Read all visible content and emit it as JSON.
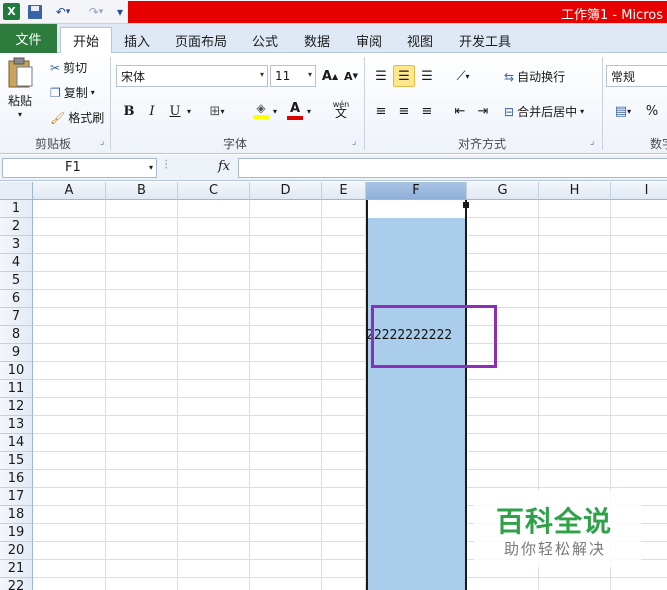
{
  "window": {
    "title": "工作簿1 - Micros"
  },
  "quick_access": {
    "undo_arrow": "▾",
    "more": "▾"
  },
  "ribbon_tabs": [
    {
      "label": "文件"
    },
    {
      "label": "开始"
    },
    {
      "label": "插入"
    },
    {
      "label": "页面布局"
    },
    {
      "label": "公式"
    },
    {
      "label": "数据"
    },
    {
      "label": "审阅"
    },
    {
      "label": "视图"
    },
    {
      "label": "开发工具"
    }
  ],
  "clipboard": {
    "paste": "粘贴",
    "cut": "剪切",
    "copy": "复制",
    "format_painter": "格式刷",
    "group": "剪贴板"
  },
  "font": {
    "name": "宋体",
    "size": "11",
    "grow": "A",
    "shrink": "A",
    "bold": "B",
    "italic": "I",
    "underline": "U",
    "font_color_glyph": "A",
    "phonetic": "wén",
    "phonetic_glyph": "文",
    "group": "字体"
  },
  "alignment": {
    "wrap": "自动换行",
    "merge": "合并后居中",
    "group": "对齐方式"
  },
  "number": {
    "format": "常规",
    "percent": "%",
    "group": "数字"
  },
  "formula_bar": {
    "name_box": "F1",
    "fx": "fx",
    "content": ""
  },
  "columns": [
    "A",
    "B",
    "C",
    "D",
    "E",
    "F",
    "G",
    "H",
    "I"
  ],
  "selected_column": "F",
  "rows": [
    "1",
    "2",
    "3",
    "4",
    "5",
    "6",
    "7",
    "8",
    "9",
    "10",
    "11",
    "12",
    "13",
    "14",
    "15",
    "16",
    "17",
    "18",
    "19",
    "20",
    "21",
    "22"
  ],
  "cells": {
    "F8": "22222222222"
  },
  "watermark": {
    "title": "百科全说",
    "subtitle": "助你轻松解决"
  }
}
